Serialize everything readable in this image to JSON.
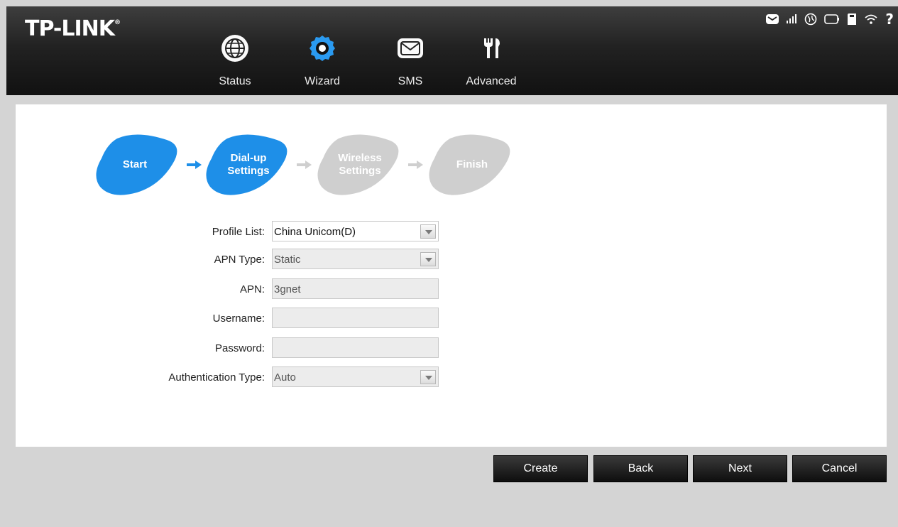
{
  "header": {
    "logo": "TP-LINK",
    "logo_mark": "®",
    "nav": [
      {
        "label": "Status",
        "icon": "globe-icon"
      },
      {
        "label": "Wizard",
        "icon": "wizard-gear-icon",
        "active": true
      },
      {
        "label": "SMS",
        "icon": "envelope-icon"
      },
      {
        "label": "Advanced",
        "icon": "tools-icon"
      }
    ],
    "status_icons": [
      "sms-icon",
      "signal-icon",
      "internet-icon",
      "battery-icon",
      "sd-card-icon",
      "wifi-icon",
      "help-icon"
    ],
    "help_text": "?"
  },
  "wizard": {
    "steps": [
      {
        "label_1": "Start",
        "label_2": "",
        "state": "done"
      },
      {
        "label_1": "Dial-up",
        "label_2": "Settings",
        "state": "current"
      },
      {
        "label_1": "Wireless",
        "label_2": "Settings",
        "state": "pending"
      },
      {
        "label_1": "Finish",
        "label_2": "",
        "state": "pending"
      }
    ],
    "colors": {
      "active": "#1e8fe8",
      "inactive": "#cfcfcf"
    }
  },
  "form": {
    "profile_list": {
      "label": "Profile List:",
      "value": "China Unicom(D)"
    },
    "apn_type": {
      "label": "APN Type:",
      "value": "Static"
    },
    "apn": {
      "label": "APN:",
      "value": "3gnet"
    },
    "username": {
      "label": "Username:",
      "value": ""
    },
    "password": {
      "label": "Password:",
      "value": ""
    },
    "auth_type": {
      "label": "Authentication Type:",
      "value": "Auto"
    }
  },
  "buttons": {
    "create": "Create",
    "back": "Back",
    "next": "Next",
    "cancel": "Cancel"
  }
}
